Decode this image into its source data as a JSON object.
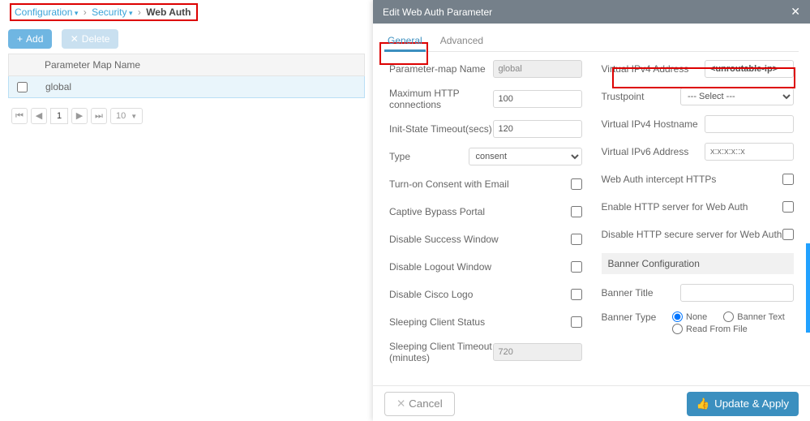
{
  "breadcrumb": {
    "items": [
      "Configuration",
      "Security"
    ],
    "current": "Web Auth"
  },
  "toolbar": {
    "add": "Add",
    "delete": "Delete"
  },
  "grid": {
    "header": "Parameter Map Name",
    "rows": [
      "global"
    ]
  },
  "pager": {
    "first": "⏮",
    "prev": "◀",
    "page": "1",
    "next": "▶",
    "last": "⏭",
    "size": "10"
  },
  "panel": {
    "title": "Edit Web Auth Parameter",
    "tabs": {
      "general": "General",
      "advanced": "Advanced"
    },
    "left_fields": {
      "param_name_lbl": "Parameter-map Name",
      "param_name": "global",
      "max_http_lbl": "Maximum HTTP connections",
      "max_http": "100",
      "init_state_lbl": "Init-State Timeout(secs)",
      "init_state": "120",
      "type_lbl": "Type",
      "type": "consent",
      "turn_consent": "Turn-on Consent with Email",
      "captive": "Captive Bypass Portal",
      "disable_success": "Disable Success Window",
      "disable_logout": "Disable Logout Window",
      "disable_logo": "Disable Cisco Logo",
      "sleep_status": "Sleeping Client Status",
      "sleep_timeout_lbl": "Sleeping Client Timeout (minutes)",
      "sleep_timeout": "720"
    },
    "right_fields": {
      "vip4_lbl": "Virtual IPv4 Address",
      "vip4": "<unroutable-ip>",
      "trust_lbl": "Trustpoint",
      "trust": "--- Select ---",
      "vhost_lbl": "Virtual IPv4 Hostname",
      "vhost": "",
      "vip6_lbl": "Virtual IPv6 Address",
      "vip6": "x:x:x:x::x",
      "intercept": "Web Auth intercept HTTPs",
      "enable_http": "Enable HTTP server for Web Auth",
      "disable_https": "Disable HTTP secure server for Web Auth",
      "banner_section": "Banner Configuration",
      "banner_title_lbl": "Banner Title",
      "banner_title": "",
      "banner_type_lbl": "Banner Type",
      "bt_none": "None",
      "bt_text": "Banner Text",
      "bt_file": "Read From File"
    },
    "footer": {
      "cancel": "Cancel",
      "apply": "Update & Apply"
    }
  }
}
